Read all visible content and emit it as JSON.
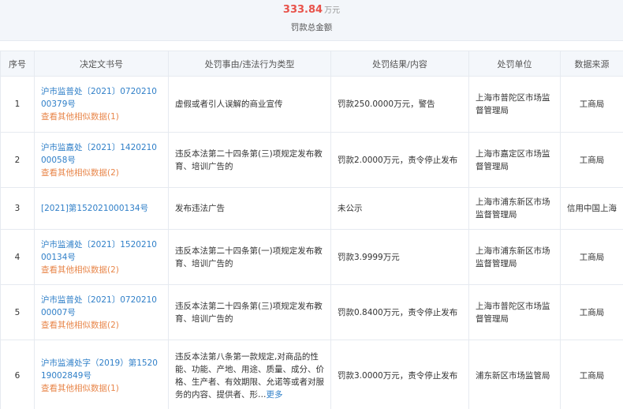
{
  "summary": {
    "amount": "333.84",
    "unit": "万元",
    "label": "罚款总金额"
  },
  "table": {
    "headers": [
      "序号",
      "决定文书号",
      "处罚事由/违法行为类型",
      "处罚结果/内容",
      "处罚单位",
      "数据来源"
    ],
    "rows": [
      {
        "index": "1",
        "doc": "沪市监普处〔2021〕072021000379号",
        "similar": "查看其他相似数据(1)",
        "reason": "虚假或者引人误解的商业宣传",
        "result": "罚款250.0000万元，警告",
        "unit": "上海市普陀区市场监督管理局",
        "source": "工商局"
      },
      {
        "index": "2",
        "doc": "沪市监嘉处〔2021〕142021000058号",
        "similar": "查看其他相似数据(2)",
        "reason": "违反本法第二十四条第(三)项规定发布教育、培训广告的",
        "result": "罚款2.0000万元，责令停止发布",
        "unit": "上海市嘉定区市场监督管理局",
        "source": "工商局"
      },
      {
        "index": "3",
        "doc": "[2021]第152021000134号",
        "similar": "",
        "reason": "发布违法广告",
        "result": "未公示",
        "unit": "上海市浦东新区市场监督管理局",
        "source": "信用中国上海"
      },
      {
        "index": "4",
        "doc": "沪市监浦处〔2021〕152021000134号",
        "similar": "查看其他相似数据(2)",
        "reason": "违反本法第二十四条第(一)项规定发布教育、培训广告的",
        "result": "罚款3.9999万元",
        "unit": "上海市浦东新区市场监督管理局",
        "source": "工商局"
      },
      {
        "index": "5",
        "doc": "沪市监普处〔2021〕072021000007号",
        "similar": "查看其他相似数据(2)",
        "reason": "违反本法第二十四条第(三)项规定发布教育、培训广告的",
        "result": "罚款0.8400万元，责令停止发布",
        "unit": "上海市普陀区市场监督管理局",
        "source": "工商局"
      },
      {
        "index": "6",
        "doc": "沪市监浦处字（2019）第152019002849号",
        "similar": "查看其他相似数据(1)",
        "reason": "违反本法第八条第一款规定,对商品的性能、功能、产地、用途、质量、成分、价格、生产者、有效期限、允诺等或者对服务的内容、提供者、形…",
        "more": "更多",
        "result": "罚款3.0000万元，责令停止发布",
        "unit": "浦东新区市场监管局",
        "source": "工商局"
      }
    ]
  }
}
